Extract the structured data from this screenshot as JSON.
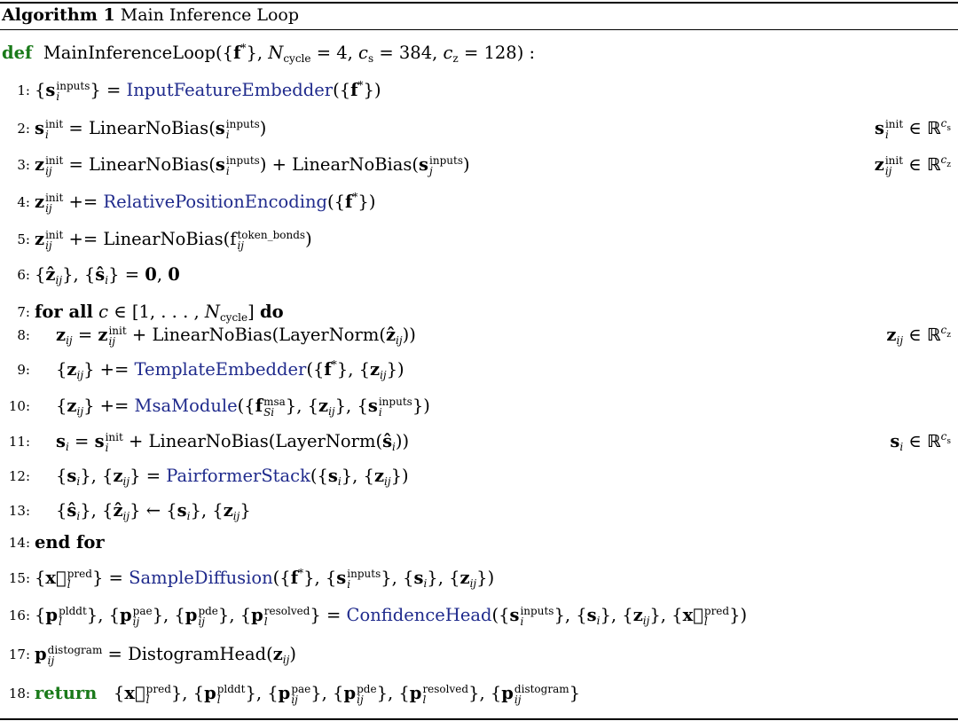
{
  "caption": {
    "label": "Algorithm 1",
    "title": "Main Inference Loop"
  },
  "signature": {
    "keyword": "def",
    "text": "MainInferenceLoop({f*}, Ncycle = 4, cs = 384, cz = 128) :"
  },
  "lines": [
    {
      "num": "1:",
      "code": "{s_i^inputs} = InputFeatureEmbedder({f*})",
      "fn": "InputFeatureEmbedder",
      "comment": ""
    },
    {
      "num": "2:",
      "code": "s_i^init = LinearNoBias(s_i^inputs)",
      "fn": "",
      "comment": "s_i^init ∈ ℝ^cs"
    },
    {
      "num": "3:",
      "code": "z_ij^init = LinearNoBias(s_i^inputs) + LinearNoBias(s_j^inputs)",
      "fn": "",
      "comment": "z_ij^init ∈ ℝ^cz"
    },
    {
      "num": "4:",
      "code": "z_ij^init += RelativePositionEncoding({f*})",
      "fn": "RelativePositionEncoding",
      "comment": ""
    },
    {
      "num": "5:",
      "code": "z_ij^init += LinearNoBias(f_ij^token_bonds)",
      "fn": "",
      "comment": ""
    },
    {
      "num": "6:",
      "code": "{ẑ_ij}, {ŝ_i} = 0, 0",
      "fn": "",
      "comment": ""
    },
    {
      "num": "7:",
      "code": "for all c ∈ [1, . . . , Ncycle] do",
      "fn": "",
      "comment": ""
    },
    {
      "num": "8:",
      "code": "z_ij = z_ij^init + LinearNoBias(LayerNorm(ẑ_ij))",
      "fn": "",
      "comment": "z_ij ∈ ℝ^cz"
    },
    {
      "num": "9:",
      "code": "{z_ij} += TemplateEmbedder({f*}, {z_ij})",
      "fn": "TemplateEmbedder",
      "comment": ""
    },
    {
      "num": "10:",
      "code": "{z_ij} += MsaModule({f_Si^msa}, {z_ij}, {s_i^inputs})",
      "fn": "MsaModule",
      "comment": ""
    },
    {
      "num": "11:",
      "code": "s_i = s_i^init + LinearNoBias(LayerNorm(ŝ_i))",
      "fn": "",
      "comment": "s_i ∈ ℝ^cs"
    },
    {
      "num": "12:",
      "code": "{s_i}, {z_ij} = PairformerStack({s_i}, {z_ij})",
      "fn": "PairformerStack",
      "comment": ""
    },
    {
      "num": "13:",
      "code": "{ŝ_i}, {ẑ_ij} ← {s_i}, {z_ij}",
      "fn": "",
      "comment": ""
    },
    {
      "num": "14:",
      "code": "end for",
      "fn": "",
      "comment": ""
    },
    {
      "num": "15:",
      "code": "{x_l^pred} = SampleDiffusion({f*}, {s_i^inputs}, {s_i}, {z_ij})",
      "fn": "SampleDiffusion",
      "comment": ""
    },
    {
      "num": "16:",
      "code": "{p_l^plddt}, {p_ij^pae}, {p_ij^pde}, {p_l^resolved} = ConfidenceHead({s_i^inputs}, {s_i}, {z_ij}, {x_l^pred})",
      "fn": "ConfidenceHead",
      "comment": ""
    },
    {
      "num": "17:",
      "code": "p_ij^distogram = DistogramHead(z_ij)",
      "fn": "",
      "comment": ""
    },
    {
      "num": "18:",
      "code": "return {x_l^pred}, {p_l^plddt}, {p_ij^pae}, {p_ij^pde}, {p_l^resolved}, {p_ij^distogram}",
      "fn": "",
      "comment": ""
    }
  ],
  "keywords": {
    "for_all": "for all",
    "do": "do",
    "end_for": "end for",
    "return": "return"
  },
  "colors": {
    "function": "#1f2a8c",
    "keyword_green": "#1a7a1a",
    "text": "#000000"
  }
}
